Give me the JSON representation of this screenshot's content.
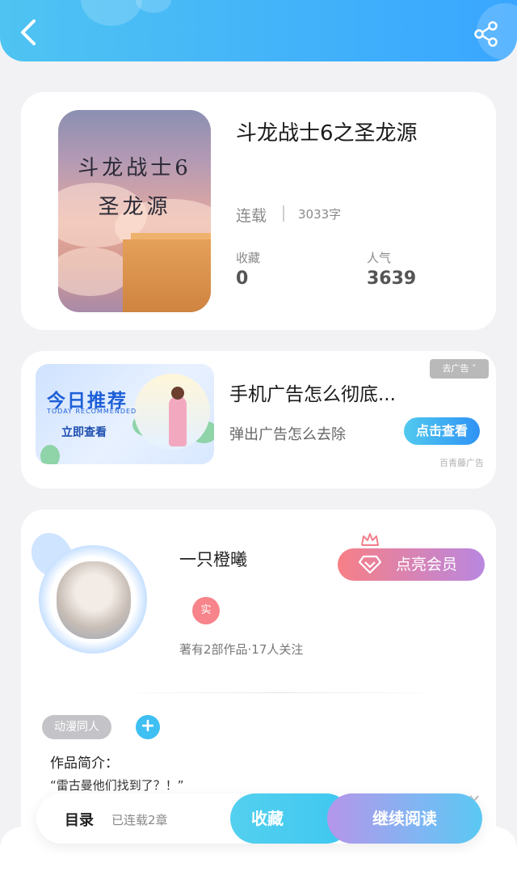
{
  "header": {
    "back_icon": "chevron-left-icon",
    "share_icon": "share-icon",
    "gradient": [
      "#4fc4f2",
      "#39a6ff"
    ]
  },
  "book": {
    "cover_title_line1": "斗龙战士6",
    "cover_title_line2": "圣龙源",
    "title": "斗龙战士6之圣龙源",
    "status": "连载",
    "word_count": "3033字",
    "favorites_label": "收藏",
    "favorites_value": "0",
    "popularity_label": "人气",
    "popularity_value": "3639"
  },
  "ad": {
    "image_headline": "今日推荐",
    "image_subline": "TODAY RECOMMENDED",
    "image_cta": "立即查看",
    "title": "手机广告怎么彻底...",
    "description": "弹出广告怎么去除",
    "button": "点击查看",
    "remove": "去广告 ˅",
    "source": "百青藤广告"
  },
  "author": {
    "name": "一只橙曦",
    "vip_button": "点亮会员",
    "verified_badge": "实",
    "works_info": "著有2部作品·17人关注",
    "tag": "动漫同人",
    "add_tag": "+",
    "intro_label": "作品简介：",
    "intro_text": "“雷古曼他们找到了？！”"
  },
  "bottom_bar": {
    "toc": "目录",
    "chapters": "已连载2章",
    "collect": "收藏",
    "continue": "继续阅读"
  },
  "colors": {
    "accent": "#3fbff2",
    "vip_start": "#f77f86",
    "vip_end": "#b987e0",
    "verified": "#f7848a"
  }
}
